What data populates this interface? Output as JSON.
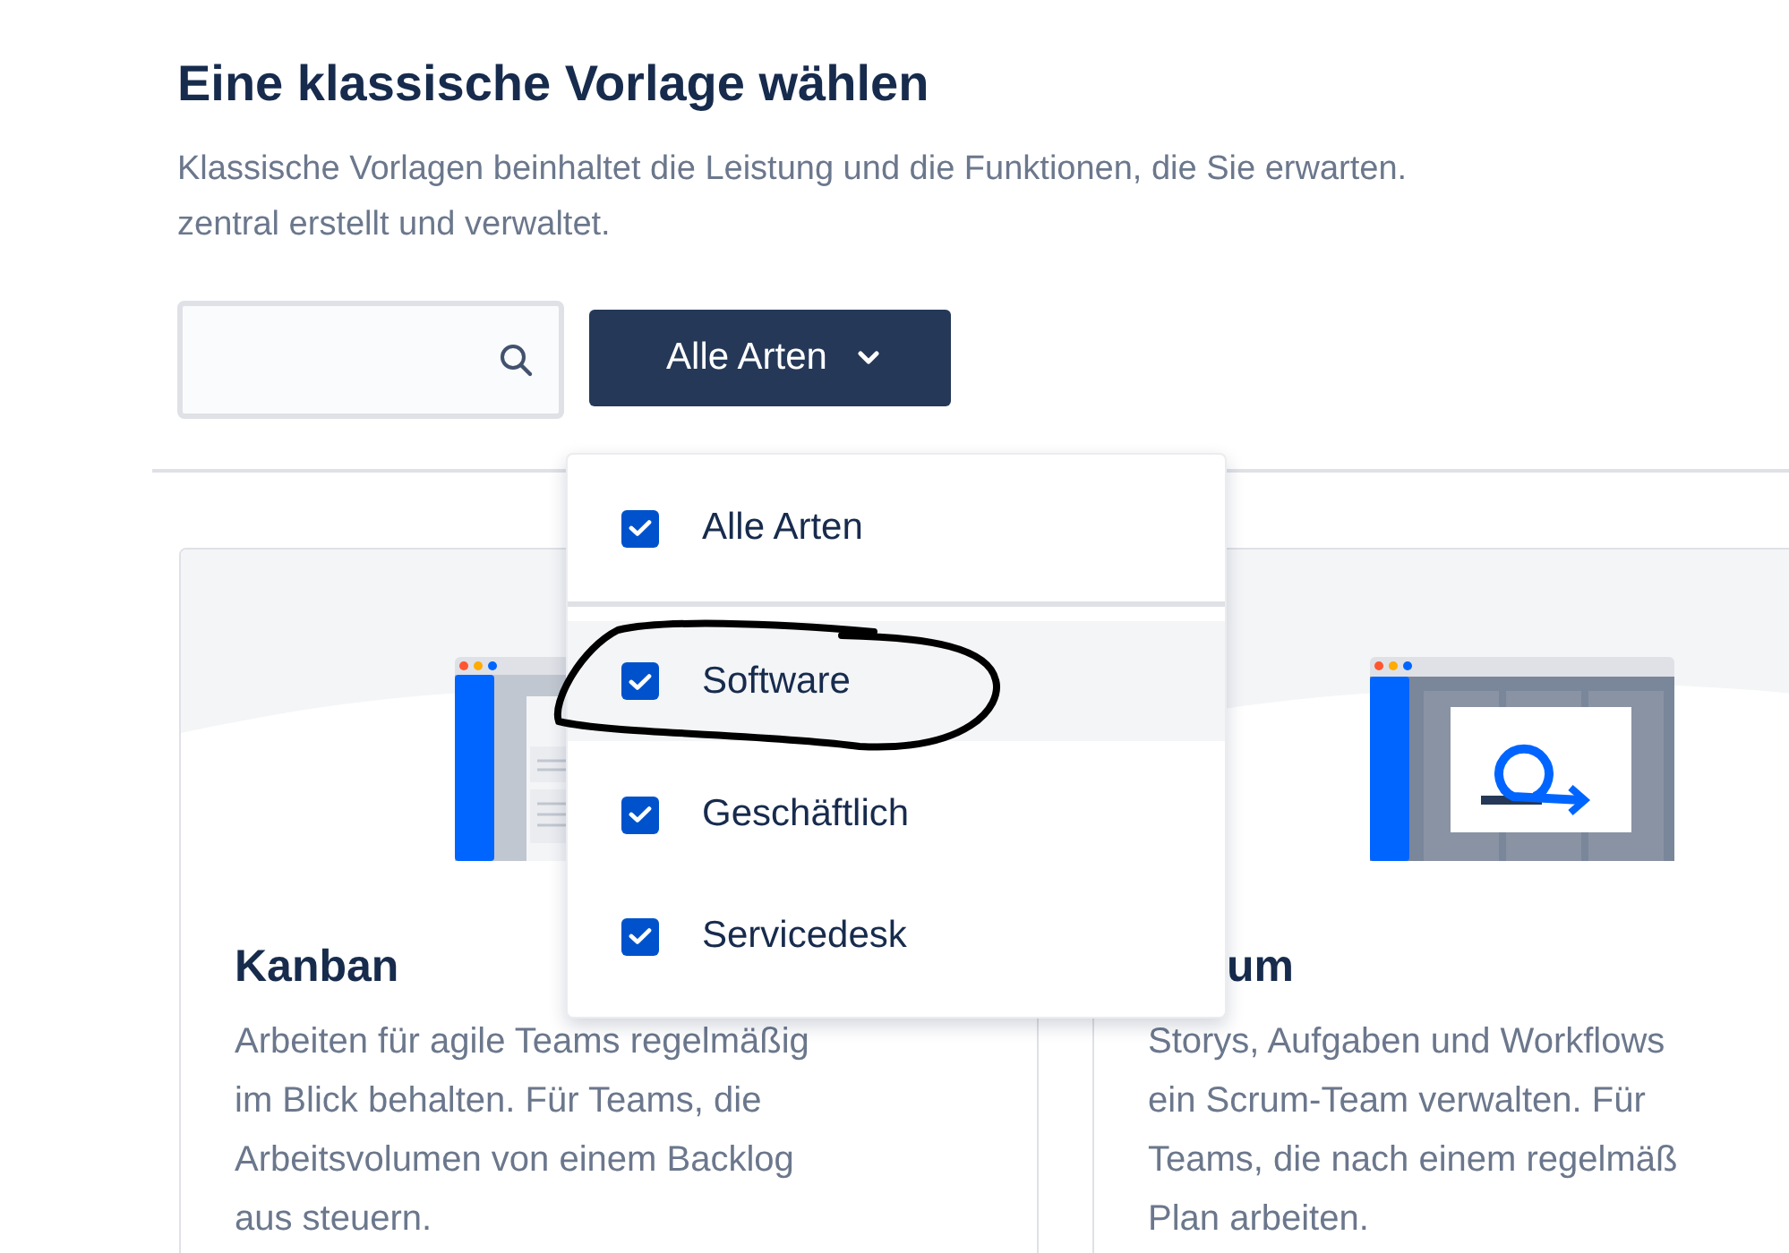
{
  "heading": "Eine klassische Vorlage wählen",
  "intro_lines": [
    "Klassische Vorlagen beinhaltet die Leistung und die Funktionen, die Sie erwarten.",
    "zentral erstellt und verwaltet."
  ],
  "filter": {
    "button_label": "Alle Arten",
    "expanded": true,
    "options": [
      {
        "kind": "all",
        "label": "Alle Arten",
        "checked": true,
        "selected": false
      },
      {
        "kind": "type",
        "label": "Software",
        "checked": true,
        "selected": true
      },
      {
        "kind": "type",
        "label": "Geschäftlich",
        "checked": true,
        "selected": false
      },
      {
        "kind": "type",
        "label": "Servicedesk",
        "checked": true,
        "selected": false
      }
    ]
  },
  "cards": [
    {
      "kind": "kanban",
      "title": "Kanban",
      "description_lines": [
        "Arbeiten für agile Teams regelmäßig",
        "im Blick behalten. Für Teams, die",
        "Arbeitsvolumen von einem Backlog",
        "aus steuern."
      ]
    },
    {
      "kind": "scrum",
      "title": "um",
      "description_lines": [
        "Storys, Aufgaben und Workflows",
        "ein Scrum-Team verwalten. Für",
        "Teams, die nach einem regelmäß",
        "Plan arbeiten."
      ]
    }
  ]
}
